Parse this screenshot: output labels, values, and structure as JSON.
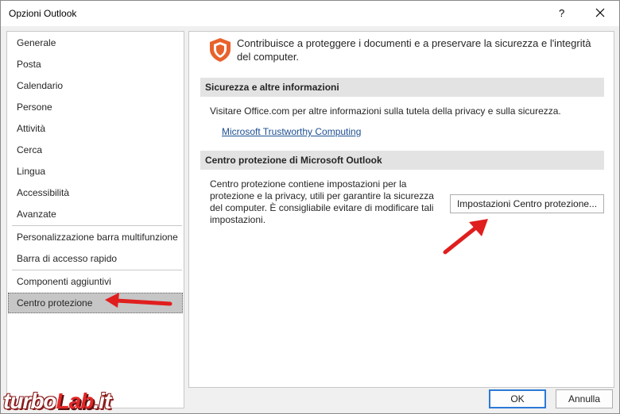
{
  "window": {
    "title": "Opzioni Outlook",
    "help_label": "?"
  },
  "sidebar": {
    "items": [
      {
        "label": "Generale"
      },
      {
        "label": "Posta"
      },
      {
        "label": "Calendario"
      },
      {
        "label": "Persone"
      },
      {
        "label": "Attività"
      },
      {
        "label": "Cerca"
      },
      {
        "label": "Lingua"
      },
      {
        "label": "Accessibilità"
      },
      {
        "label": "Avanzate"
      },
      {
        "label": "Personalizzazione barra multifunzione"
      },
      {
        "label": "Barra di accesso rapido"
      },
      {
        "label": "Componenti aggiuntivi"
      },
      {
        "label": "Centro protezione",
        "selected": true
      }
    ]
  },
  "main": {
    "intro": "Contribuisce a proteggere i documenti e a preservare la sicurezza e l'integrità del computer.",
    "sections": [
      {
        "header": "Sicurezza e altre informazioni",
        "text": "Visitare Office.com per altre informazioni sulla tutela della privacy e sulla sicurezza.",
        "link": "Microsoft Trustworthy Computing"
      },
      {
        "header": "Centro protezione di Microsoft Outlook",
        "text": "Centro protezione contiene impostazioni per la protezione e la privacy, utili per garantire la sicurezza del computer. È consigliabile evitare di modificare tali impostazioni.",
        "button": "Impostazioni Centro protezione..."
      }
    ]
  },
  "footer": {
    "ok_label": "OK",
    "cancel_label": "Annulla"
  },
  "watermark": {
    "part1": "turbo",
    "part2": "Lab",
    "part3": ".it"
  },
  "colors": {
    "shield": "#e8622c",
    "arrow": "#e01e1e",
    "ok_border": "#2b79d7"
  },
  "icons": [
    "close-icon",
    "shield-icon"
  ]
}
